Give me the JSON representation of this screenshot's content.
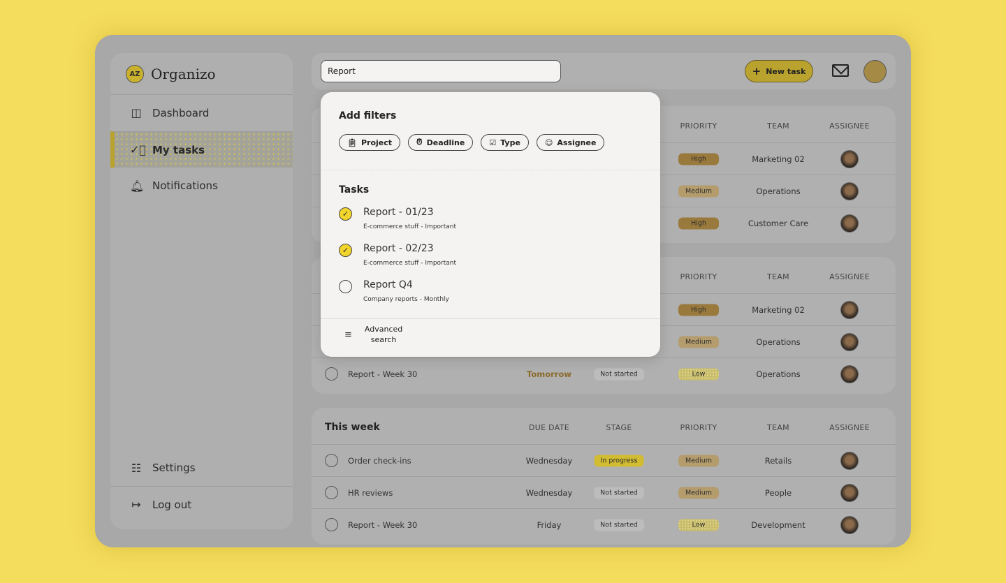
{
  "colors": {
    "background": "#f4dc5c",
    "accent": "#b9a22e",
    "check": "#f2d52c"
  },
  "sidebar": {
    "logo_badge": "AZ",
    "logo_text": "Organizo",
    "items": [
      {
        "label": "Dashboard",
        "icon": "layout-icon",
        "active": false
      },
      {
        "label": "My tasks",
        "icon": "check-circle-icon",
        "active": true
      },
      {
        "label": "Notifications",
        "icon": "bell-icon",
        "active": false
      }
    ],
    "bottom": [
      {
        "label": "Settings",
        "icon": "sliders-icon"
      },
      {
        "label": "Log out",
        "icon": "logout-icon"
      }
    ]
  },
  "topbar": {
    "search_value": "Report",
    "new_task": "New task"
  },
  "headers": {
    "due": "DUE DATE",
    "stage": "STAGE",
    "priority": "PRIORITY",
    "team": "TEAM",
    "assignee": "ASSIGNEE"
  },
  "groups": [
    {
      "title": "",
      "rows": [
        {
          "name": "",
          "due": "",
          "stage": "",
          "priority": "High",
          "team": "Marketing 02"
        },
        {
          "name": "",
          "due": "",
          "stage": "",
          "priority": "Medium",
          "team": "Operations"
        },
        {
          "name": "",
          "due": "",
          "stage": "",
          "priority": "High",
          "team": "Customer Care"
        }
      ]
    },
    {
      "title": "",
      "rows": [
        {
          "name": "",
          "due": "",
          "stage": "",
          "priority": "High",
          "team": "Marketing 02"
        },
        {
          "name": "",
          "due": "",
          "stage": "",
          "priority": "Medium",
          "team": "Operations"
        },
        {
          "name": "Report - Week 30",
          "due": "Tomorrow",
          "stage": "Not started",
          "priority": "Low",
          "team": "Operations"
        }
      ]
    },
    {
      "title": "This week",
      "rows": [
        {
          "name": "Order check-ins",
          "due": "Wednesday",
          "stage": "In progress",
          "priority": "Medium",
          "team": "Retails"
        },
        {
          "name": "HR reviews",
          "due": "Wednesday",
          "stage": "Not started",
          "priority": "Medium",
          "team": "People"
        },
        {
          "name": "Report - Week 30",
          "due": "Friday",
          "stage": "Not started",
          "priority": "Low",
          "team": "Development"
        }
      ]
    }
  ],
  "popup": {
    "filters_title": "Add filters",
    "filters": [
      {
        "label": "Project",
        "icon": "clipboard-icon"
      },
      {
        "label": "Deadline",
        "icon": "alarm-icon"
      },
      {
        "label": "Type",
        "icon": "checklist-icon"
      },
      {
        "label": "Assignee",
        "icon": "face-icon"
      }
    ],
    "tasks_title": "Tasks",
    "tasks": [
      {
        "name": "Report - 01/23",
        "sub": "E-commerce stuff - Important",
        "checked": true
      },
      {
        "name": "Report - 02/23",
        "sub": "E-commerce stuff - Important",
        "checked": true
      },
      {
        "name": "Report Q4",
        "sub": "Company reports - Monthly",
        "checked": false
      }
    ],
    "advanced_line1": "Advanced",
    "advanced_line2": "search"
  }
}
